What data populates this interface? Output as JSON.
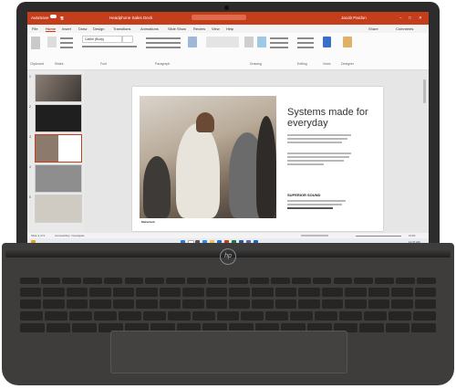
{
  "title_bar": {
    "autosave": "AutoSave",
    "file_name": "Headphone Sales Deck",
    "user": "Jacob Pardon"
  },
  "menu_tabs": [
    "File",
    "Home",
    "Insert",
    "Draw",
    "Design",
    "Transitions",
    "Animations",
    "Slide Show",
    "Review",
    "View",
    "Help"
  ],
  "ribbon": {
    "share": "Share",
    "comments": "Comments",
    "font_name": "Calibri (Body)",
    "groups": [
      "Clipboard",
      "Slides",
      "Font",
      "Paragraph",
      "Drawing",
      "Editing",
      "Voice",
      "Designer"
    ]
  },
  "slide_numbers": [
    "1",
    "2",
    "3",
    "4",
    "5"
  ],
  "slide": {
    "title": "Systems made for everyday",
    "subheading": "SUPERIOR SOUND",
    "caption": "Makerlunk"
  },
  "status_bar": {
    "slide_indicator": "Slide 3 of 9",
    "accessibility": "Accessibility: Investigate",
    "zoom": "101%"
  },
  "taskbar": {
    "time": "11:47 AM"
  },
  "hardware": {
    "logo": "hp"
  }
}
